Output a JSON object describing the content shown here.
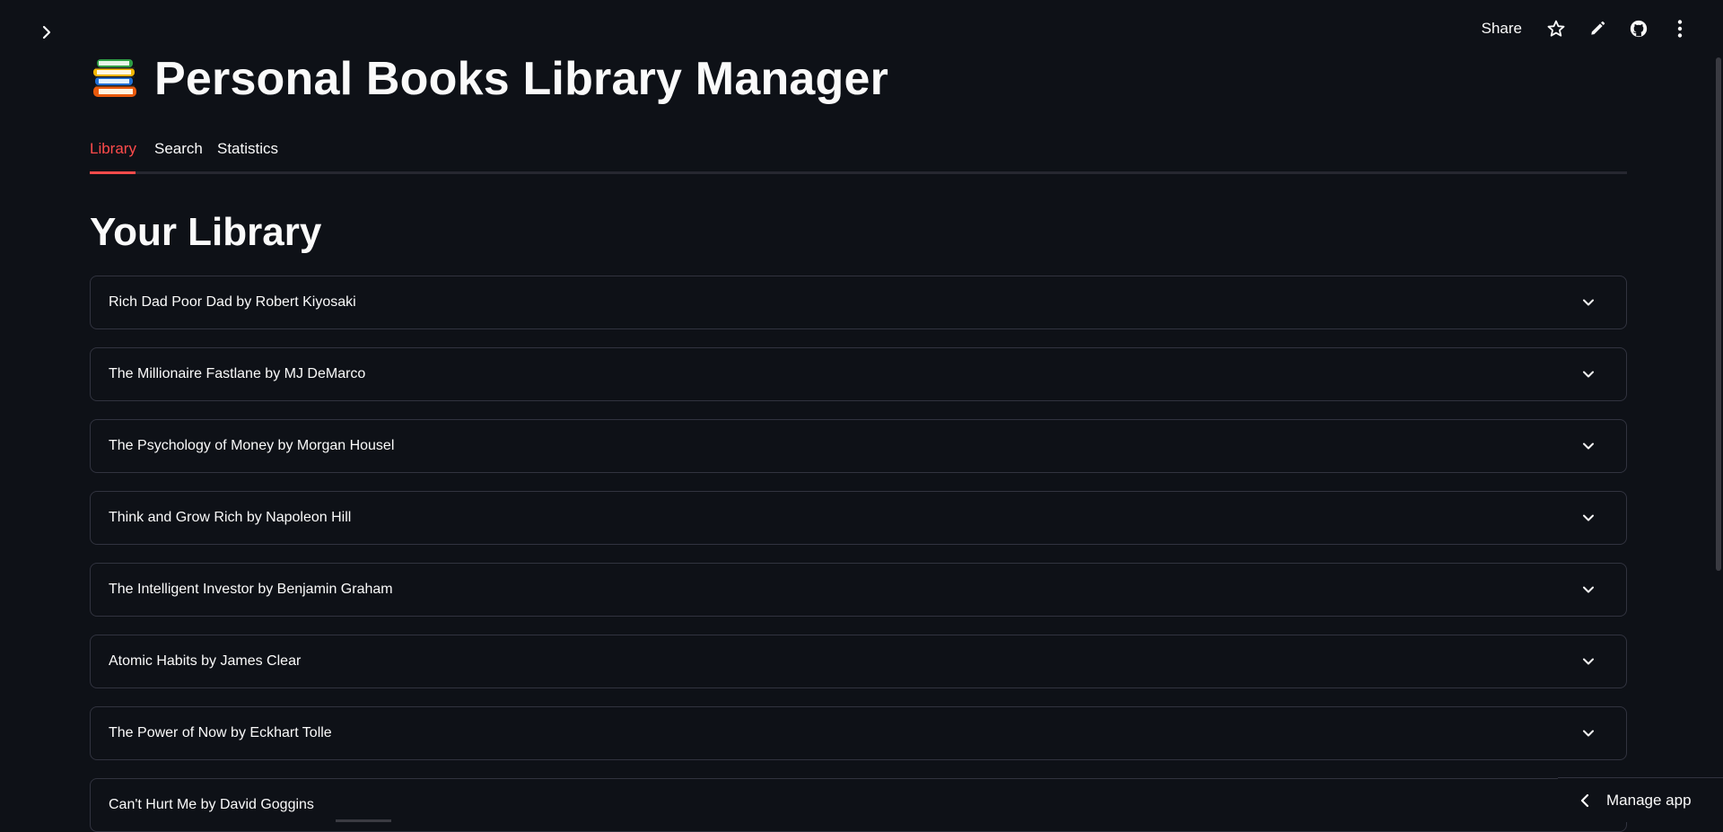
{
  "app": {
    "title": "Personal Books Library Manager",
    "logo_icon": "books-emoji-icon"
  },
  "toolbar": {
    "share_label": "Share",
    "icons": [
      "star-icon",
      "pencil-icon",
      "github-icon",
      "kebab-menu-icon"
    ]
  },
  "tabs": [
    {
      "label": "Library",
      "active": true
    },
    {
      "label": "Search",
      "active": false
    },
    {
      "label": "Statistics",
      "active": false
    }
  ],
  "library": {
    "heading": "Your Library",
    "books": [
      {
        "label": "Rich Dad Poor Dad by Robert Kiyosaki"
      },
      {
        "label": "The Millionaire Fastlane by MJ DeMarco"
      },
      {
        "label": "The Psychology of Money by Morgan Housel"
      },
      {
        "label": "Think and Grow Rich by Napoleon Hill"
      },
      {
        "label": "The Intelligent Investor by Benjamin Graham"
      },
      {
        "label": "Atomic Habits by James Clear"
      },
      {
        "label": "The Power of Now by Eckhart Tolle"
      },
      {
        "label": "Can't Hurt Me by David Goggins"
      }
    ]
  },
  "manage_app": {
    "label": "Manage app"
  },
  "colors": {
    "background": "#0e1117",
    "accent": "#ff4b4b",
    "border": "#31333f",
    "text": "#fafafa"
  }
}
